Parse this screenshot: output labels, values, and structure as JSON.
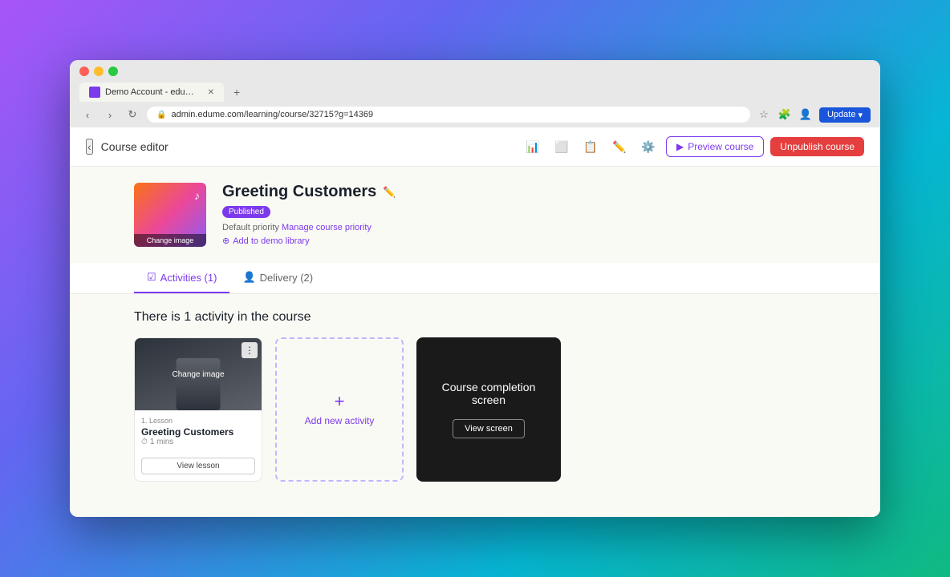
{
  "browser": {
    "tab_title": "Demo Account - eduMe Contr...",
    "url": "admin.edume.com/learning/course/32715?g=14369",
    "new_tab_label": "+",
    "update_button": "Update"
  },
  "app": {
    "back_label": "‹",
    "page_title": "Course editor",
    "toolbar_icons": [
      "bar-chart",
      "copy",
      "clipboard",
      "pencil",
      "settings"
    ],
    "preview_button": "Preview course",
    "unpublish_button": "Unpublish course"
  },
  "course": {
    "name": "Greeting Customers",
    "status": "Published",
    "priority_label": "Default priority",
    "manage_priority_label": "Manage course priority",
    "add_library_label": "Add to demo library",
    "image_overlay": "Change image"
  },
  "tabs": [
    {
      "label": "Activities (1)",
      "active": true
    },
    {
      "label": "Delivery (2)",
      "active": false
    }
  ],
  "activities_section": {
    "title": "There is 1 activity in the course",
    "activity": {
      "type": "1. Lesson",
      "name": "Greeting Customers",
      "duration": "1 mins",
      "image_overlay": "Change image",
      "view_button": "View lesson"
    },
    "add_activity": {
      "icon": "+",
      "label": "Add new activity"
    },
    "completion_screen": {
      "title": "Course completion screen",
      "view_button": "View screen"
    }
  }
}
